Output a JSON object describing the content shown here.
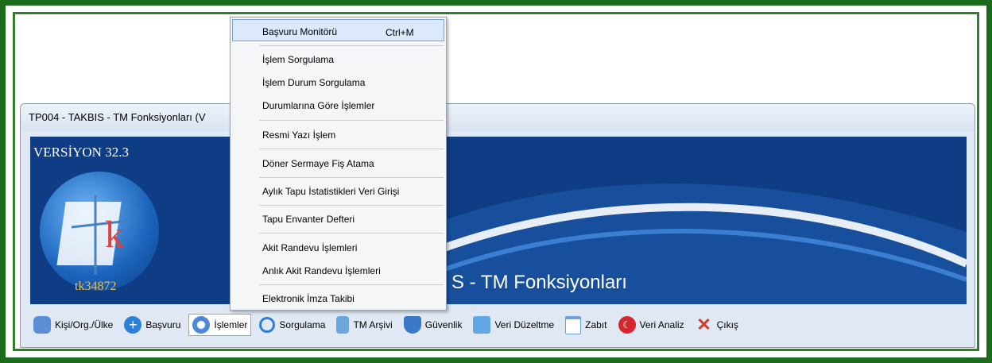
{
  "window": {
    "title": "TP004 - TAKBIS - TM Fonksiyonları  (V"
  },
  "banner": {
    "version": "VERSİYON 32.3",
    "user_code": "tk34872",
    "title": "S - TM Fonksiyonları"
  },
  "menu": {
    "items": [
      {
        "label": "Başvuru Monitörü",
        "shortcut": "Ctrl+M"
      },
      {
        "label": "İşlem Sorgulama"
      },
      {
        "label": "İşlem Durum Sorgulama"
      },
      {
        "label": "Durumlarına Göre İşlemler"
      },
      {
        "label": "Resmi Yazı İşlem"
      },
      {
        "label": "Döner Sermaye Fiş Atama"
      },
      {
        "label": "Aylık Tapu İstatistikleri Veri Girişi"
      },
      {
        "label": "Tapu Envanter Defteri"
      },
      {
        "label": "Akit Randevu İşlemleri"
      },
      {
        "label": "Anlık Akit Randevu İşlemleri"
      },
      {
        "label": "Elektronik İmza Takibi"
      }
    ]
  },
  "toolbar": {
    "items": [
      {
        "label": "Kişi/Org./Ülke",
        "icon": "users-icon",
        "color": "#5a8fd6"
      },
      {
        "label": "Başvuru",
        "icon": "plus-circle-icon",
        "color": "#2d7fd8"
      },
      {
        "label": "İşlemler",
        "icon": "gear-icon",
        "color": "#4a88d9"
      },
      {
        "label": "Sorgulama",
        "icon": "search-icon",
        "color": "#2f7fd8"
      },
      {
        "label": "TM Arşivi",
        "icon": "database-icon",
        "color": "#6ca6df"
      },
      {
        "label": "Güvenlik",
        "icon": "shield-icon",
        "color": "#3a78c8"
      },
      {
        "label": "Veri Düzeltme",
        "icon": "folder-icon",
        "color": "#62a7e3"
      },
      {
        "label": "Zabıt",
        "icon": "document-icon",
        "color": "#6aa0dc"
      },
      {
        "label": "Veri Analiz",
        "icon": "turkey-flag-icon",
        "color": "#d7262b"
      },
      {
        "label": "Çıkış",
        "icon": "close-icon",
        "color": "#d33a2c"
      }
    ]
  }
}
